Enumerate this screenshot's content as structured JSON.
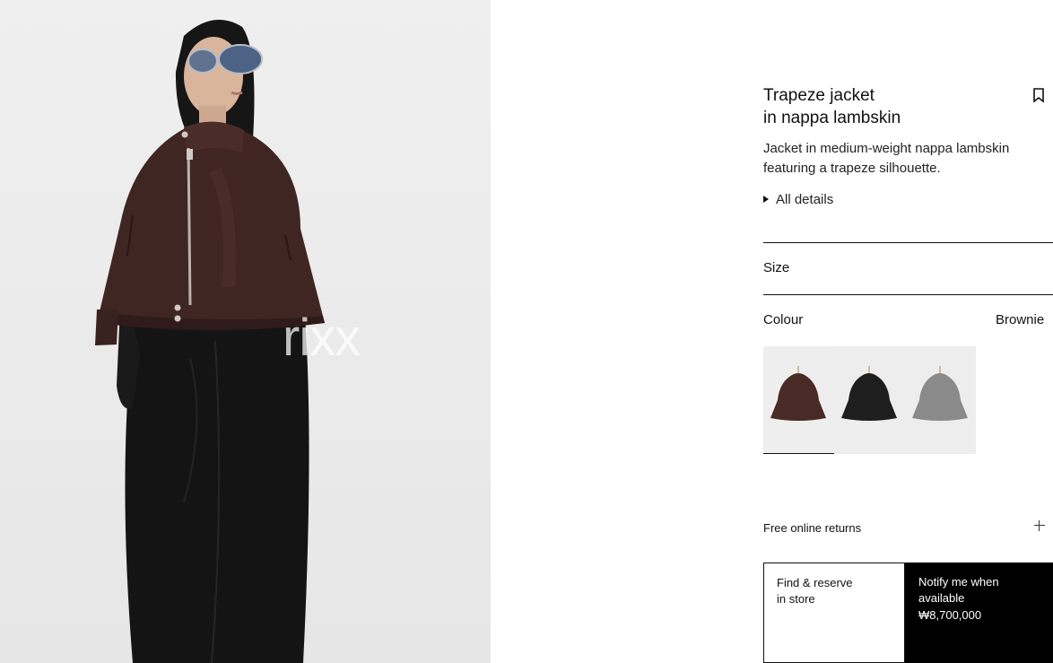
{
  "product": {
    "title_line1": "Trapeze jacket",
    "title_line2": "in nappa lambskin",
    "description": "Jacket in medium-weight nappa lambskin featuring a trapeze silhouette.",
    "all_details_label": "All details"
  },
  "size": {
    "label": "Size"
  },
  "colour": {
    "label": "Colour",
    "selected": "Brownie",
    "swatches": [
      {
        "name": "Brownie",
        "color": "#4a2a26",
        "active": true
      },
      {
        "name": "Black",
        "color": "#1e1e1e",
        "active": false
      },
      {
        "name": "Grey",
        "color": "#8a8a8a",
        "active": false
      }
    ]
  },
  "returns": {
    "label": "Free online returns"
  },
  "actions": {
    "find_line1": "Find & reserve",
    "find_line2": "in store",
    "notify_line1": "Notify me when",
    "notify_line2": "available",
    "price": "₩8,700,000"
  },
  "image": {
    "watermark": "rixx"
  },
  "icons": {
    "bookmark": "bookmark-icon",
    "details": "triangle-right-icon",
    "returns_expand": "plus-icon"
  },
  "colors": {
    "jacket": "#3f2623",
    "trousers": "#141414",
    "notify_button": "#000000"
  }
}
